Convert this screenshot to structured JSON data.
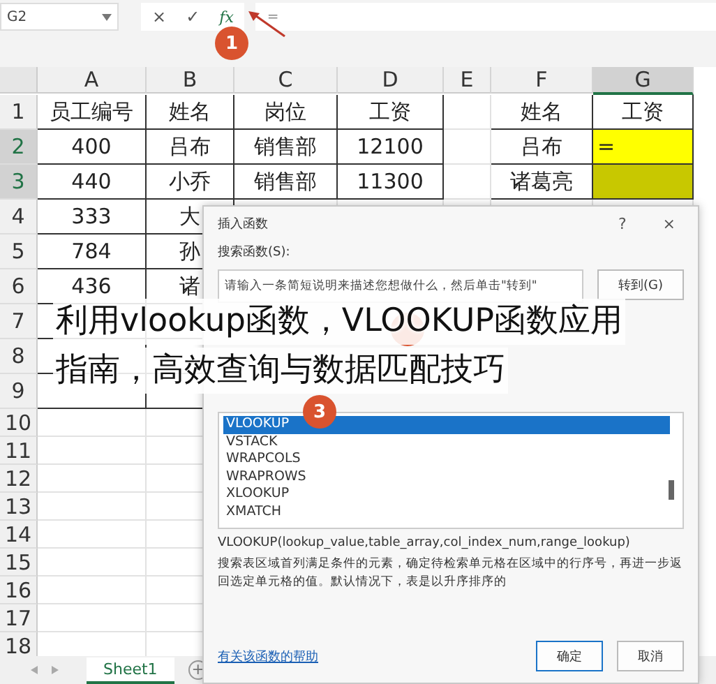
{
  "formula_bar": {
    "name_box": "G2",
    "cancel": "×",
    "enter": "✓",
    "function": "fx",
    "formula": "="
  },
  "columns": [
    {
      "label": "A",
      "selected": false
    },
    {
      "label": "B",
      "selected": false
    },
    {
      "label": "C",
      "selected": false
    },
    {
      "label": "D",
      "selected": false
    },
    {
      "label": "E",
      "selected": false
    },
    {
      "label": "F",
      "selected": false
    },
    {
      "label": "G",
      "selected": true
    }
  ],
  "rows": [
    {
      "header": "1",
      "selected": false,
      "cells": [
        {
          "text": "员工编号"
        },
        {
          "text": "姓名"
        },
        {
          "text": "岗位"
        },
        {
          "text": "工资"
        },
        {
          "text": ""
        },
        {
          "text": "姓名"
        },
        {
          "text": "工资"
        }
      ]
    },
    {
      "header": "2",
      "selected": true,
      "cells": [
        {
          "text": "400"
        },
        {
          "text": "吕布"
        },
        {
          "text": "销售部"
        },
        {
          "text": "12100"
        },
        {
          "text": ""
        },
        {
          "text": "吕布"
        },
        {
          "text": "=",
          "color": "#ffff00"
        }
      ]
    },
    {
      "header": "3",
      "selected": true,
      "cells": [
        {
          "text": "440"
        },
        {
          "text": "小乔"
        },
        {
          "text": "销售部"
        },
        {
          "text": "11300"
        },
        {
          "text": ""
        },
        {
          "text": "诸葛亮"
        },
        {
          "text": "",
          "color": "#c8c800"
        }
      ]
    },
    {
      "header": "4",
      "selected": false,
      "cells": [
        {
          "text": "333"
        },
        {
          "text": "大"
        }
      ]
    },
    {
      "header": "5",
      "selected": false,
      "cells": [
        {
          "text": "784"
        },
        {
          "text": "孙"
        }
      ]
    },
    {
      "header": "6",
      "selected": false,
      "cells": [
        {
          "text": "436"
        },
        {
          "text": "诸"
        }
      ]
    },
    {
      "header": "7",
      "selected": false,
      "cells": []
    },
    {
      "header": "8",
      "selected": false,
      "cells": []
    },
    {
      "header": "9",
      "selected": false,
      "cells": []
    },
    {
      "header": "10",
      "selected": false,
      "cells": []
    },
    {
      "header": "11",
      "selected": false,
      "cells": []
    },
    {
      "header": "12",
      "selected": false,
      "cells": []
    },
    {
      "header": "13",
      "selected": false,
      "cells": []
    },
    {
      "header": "14",
      "selected": false,
      "cells": []
    },
    {
      "header": "15",
      "selected": false,
      "cells": []
    },
    {
      "header": "16",
      "selected": false,
      "cells": []
    },
    {
      "header": "17",
      "selected": false,
      "cells": []
    },
    {
      "header": "18",
      "selected": false,
      "cells": []
    }
  ],
  "sheet_tabs": [
    {
      "label": "Sheet1",
      "selected": true
    }
  ],
  "add_sheet": "+",
  "dialog": {
    "title": "插入函数",
    "help": "?",
    "close": "×",
    "search_label": "搜索函数(S):",
    "search_placeholder": "请输入一条简短说明来描述您想做什么，然后单击\"转到\"",
    "go_button": "转到(G)",
    "functions": [
      {
        "label": "VLOOKUP",
        "selected": true
      },
      {
        "label": "VSTACK",
        "selected": false
      },
      {
        "label": "WRAPCOLS",
        "selected": false
      },
      {
        "label": "WRAPROWS",
        "selected": false
      },
      {
        "label": "XLOOKUP",
        "selected": false
      },
      {
        "label": "XMATCH",
        "selected": false
      }
    ],
    "signature": "VLOOKUP(lookup_value,table_array,col_index_num,range_lookup)",
    "description": "搜索表区域首列满足条件的元素，确定待检索单元格在区域中的行序号，再进一步返回选定单元格的值。默认情况下，表是以升序排序的",
    "help_link": "有关该函数的帮助",
    "ok_button": "确定",
    "cancel_button": "取消"
  },
  "steps": [
    "1",
    "3"
  ],
  "caption": [
    "利用vlookup函数，VLOOKUP函数应用",
    "指南，高效查询与数据匹配技巧"
  ]
}
